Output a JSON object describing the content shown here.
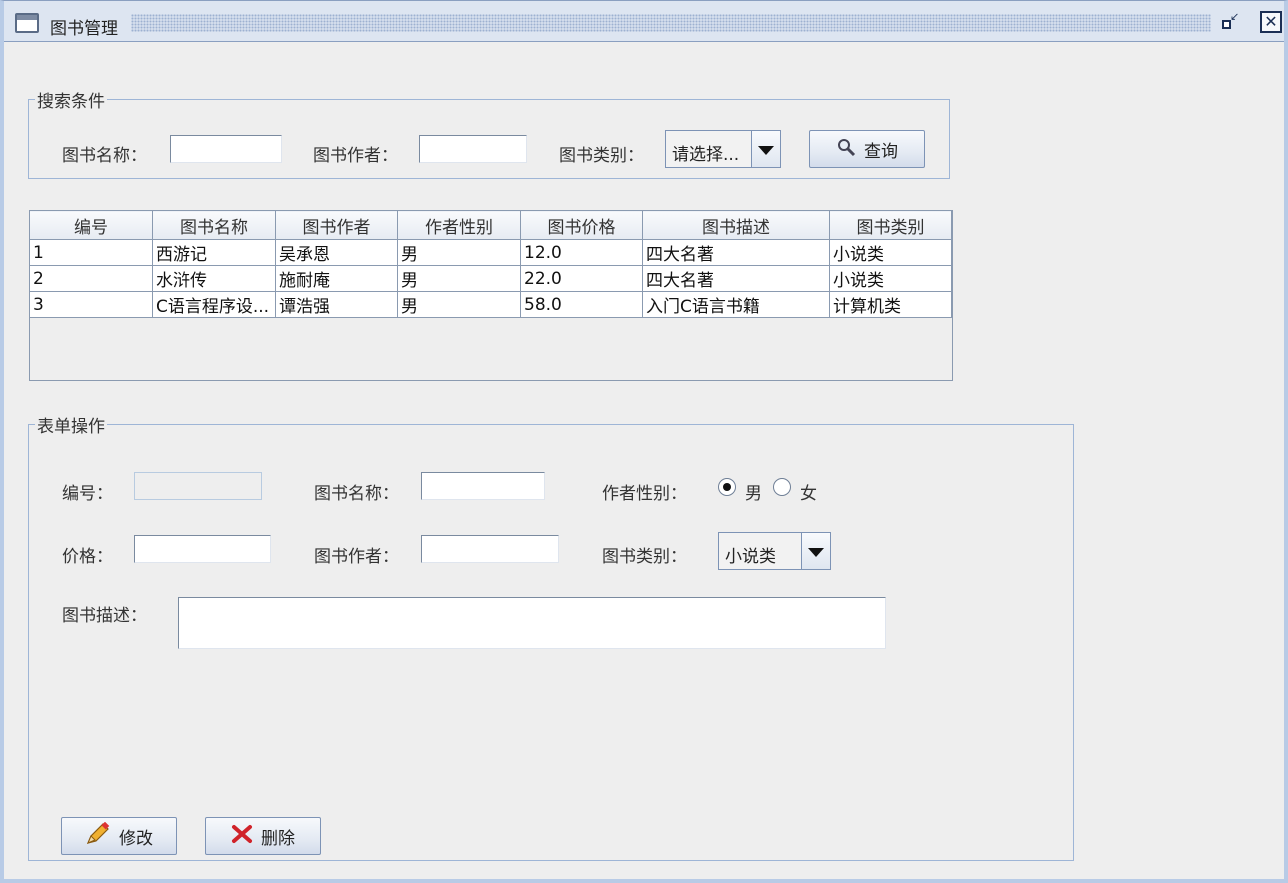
{
  "window": {
    "title": "图书管理"
  },
  "search": {
    "legend": "搜索条件",
    "name_label": "图书名称：",
    "name_value": "",
    "author_label": "图书作者：",
    "author_value": "",
    "type_label": "图书类别：",
    "type_selected": "请选择...",
    "query_button": "查询"
  },
  "table": {
    "columns": [
      "编号",
      "图书名称",
      "图书作者",
      "作者性别",
      "图书价格",
      "图书描述",
      "图书类别"
    ],
    "rows": [
      [
        "1",
        "西游记",
        "吴承恩",
        "男",
        "12.0",
        "四大名著",
        "小说类"
      ],
      [
        "2",
        "水浒传",
        "施耐庵",
        "男",
        "22.0",
        "四大名著",
        "小说类"
      ],
      [
        "3",
        "C语言程序设...",
        "谭浩强",
        "男",
        "58.0",
        "入门C语言书籍",
        "计算机类"
      ]
    ]
  },
  "form": {
    "legend": "表单操作",
    "id_label": "编号：",
    "id_value": "",
    "name_label": "图书名称：",
    "name_value": "",
    "gender_label": "作者性别：",
    "gender_male": "男",
    "gender_female": "女",
    "gender_selected": "男",
    "price_label": "价格：",
    "price_value": "",
    "author_label": "图书作者：",
    "author_value": "",
    "type_label": "图书类别：",
    "type_selected": "小说类",
    "desc_label": "图书描述：",
    "desc_value": "",
    "modify_button": "修改",
    "delete_button": "删除"
  },
  "colors": {
    "accent_border": "#9eb5d6",
    "delete_icon": "#d0232a",
    "pencil_icon": "#e8a020"
  }
}
